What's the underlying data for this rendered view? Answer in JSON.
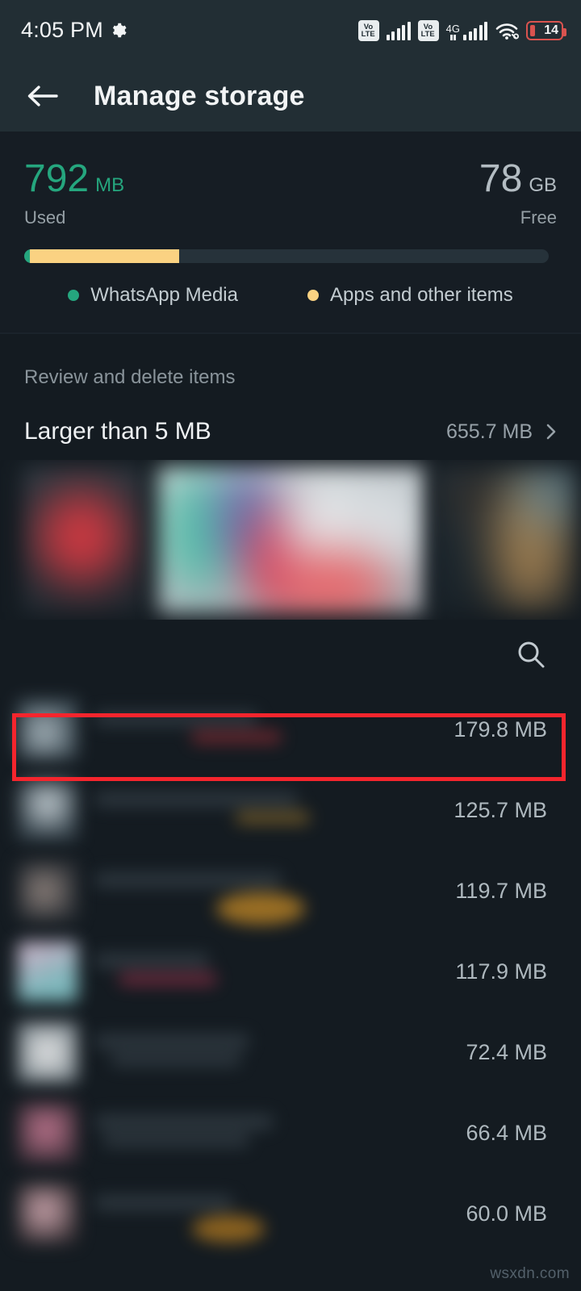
{
  "status_bar": {
    "time": "4:05 PM",
    "gear_icon": "gear-icon",
    "sim1_network": "VoLTE",
    "sim2_network": "VoLTE",
    "sim2_generation": "4G",
    "wifi_icon": "wifi-icon",
    "battery_percent": "14",
    "battery_color": "#d9534f"
  },
  "app_bar": {
    "back_icon": "back-arrow-icon",
    "title": "Manage storage"
  },
  "summary": {
    "used": {
      "value": "792",
      "unit": "MB",
      "caption": "Used",
      "color": "#25a67e"
    },
    "free": {
      "value": "78",
      "unit": "GB",
      "caption": "Free",
      "color": "#b3bcc2"
    },
    "bar": {
      "media_percent": 1.0,
      "apps_percent": 28.5,
      "track_color": "#26323a"
    },
    "legend": [
      {
        "label": "WhatsApp Media",
        "color": "#25a67e"
      },
      {
        "label": "Apps and other items",
        "color": "#fad282"
      }
    ]
  },
  "review": {
    "section_title": "Review and delete items",
    "larger_than": {
      "label": "Larger than 5 MB",
      "size": "655.7 MB",
      "chevron_icon": "chevron-right-icon"
    }
  },
  "search": {
    "icon": "search-icon"
  },
  "items": [
    {
      "size": "179.8 MB",
      "highlighted": true
    },
    {
      "size": "125.7 MB",
      "highlighted": false
    },
    {
      "size": "119.7 MB",
      "highlighted": false
    },
    {
      "size": "117.9 MB",
      "highlighted": false
    },
    {
      "size": "72.4 MB",
      "highlighted": false
    },
    {
      "size": "66.4 MB",
      "highlighted": false
    },
    {
      "size": "60.0 MB",
      "highlighted": false
    }
  ],
  "highlight": {
    "color": "#f5252d"
  },
  "watermark": {
    "text": "wsxdn.com"
  }
}
